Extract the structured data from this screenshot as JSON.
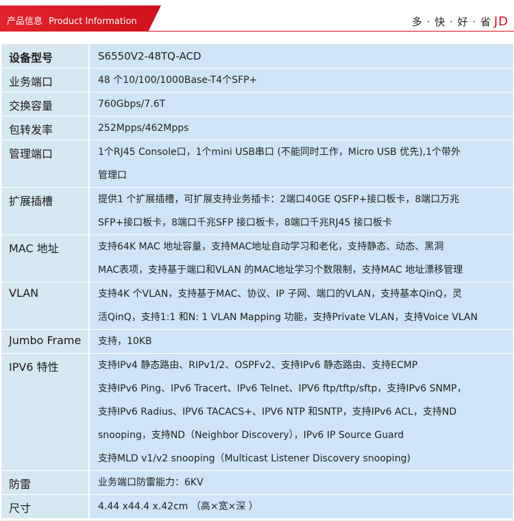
{
  "header": {
    "title_cn": "产品信息",
    "title_en": "Product Information",
    "slogan": "多 · 快 · 好 · 省",
    "brand": "JD"
  },
  "specs": [
    {
      "key": "设备型号",
      "lines": [
        "S6550V2-48TQ-ACD"
      ]
    },
    {
      "key": "业务端口",
      "lines": [
        "48 个10/100/1000Base-T4个SFP+"
      ]
    },
    {
      "key": "交换容量",
      "lines": [
        "760Gbps/7.6T"
      ]
    },
    {
      "key": "包转发率",
      "lines": [
        "252Mpps/462Mpps"
      ]
    },
    {
      "key": "管理端口",
      "lines": [
        "1个RJ45 Console口，1个mini USB串口 (不能同时工作，Micro USB 优先),1个带外",
        "管理口"
      ]
    },
    {
      "key": "扩展插槽",
      "lines": [
        "提供1 个扩展插槽，可扩展支持业务插卡：2端口40GE QSFP+接口板卡，8端口万兆",
        "SFP+接口板卡，8端口千兆SFP 接口板卡，8端口千兆RJ45 接口板卡"
      ]
    },
    {
      "key": "MAC 地址",
      "lines": [
        "支持64K MAC 地址容量，支持MAC地址自动学习和老化，支持静态、动态、黑洞",
        "MAC表项，支持基于端口和VLAN 的MAC地址学习个数限制，支持MAC 地址漂移管理"
      ]
    },
    {
      "key": "VLAN",
      "lines": [
        "支持4K 个VLAN，支持基于MAC、协议、IP 子网、端口的VLAN，支持基本QinQ，灵",
        "活QinQ，支持1:1 和N: 1 VLAN Mapping 功能，支持Private VLAN，支持Voice VLAN"
      ]
    },
    {
      "key": "Jumbo Frame",
      "lines": [
        "支持，10KB"
      ]
    },
    {
      "key": "IPV6 特性",
      "lines": [
        "支持IPv4 静态路由、RIPv1/2、OSPFv2、支持IPv6 静态路由、支持ECMP",
        "支持IPv6 Ping、IPv6 Tracert、IPv6 Telnet、IPV6 ftp/tftp/sftp，支持IPv6 SNMP，",
        "支持IPv6 Radius、IPV6 TACACS+、IPV6 NTP 和SNTP，支持IPv6 ACL，支持ND",
        "snooping，支持ND（Neighbor Discovery），IPv6 IP Source Guard",
        "支持MLD v1/v2 snooping（Multicast Listener Discovery snooping)"
      ]
    },
    {
      "key": "防雷",
      "lines": [
        "业务端口防雷能力：6KV"
      ]
    },
    {
      "key": "尺寸",
      "lines": [
        "4.44 x44.4 x.42cm （高×宽×深 ）"
      ]
    }
  ]
}
